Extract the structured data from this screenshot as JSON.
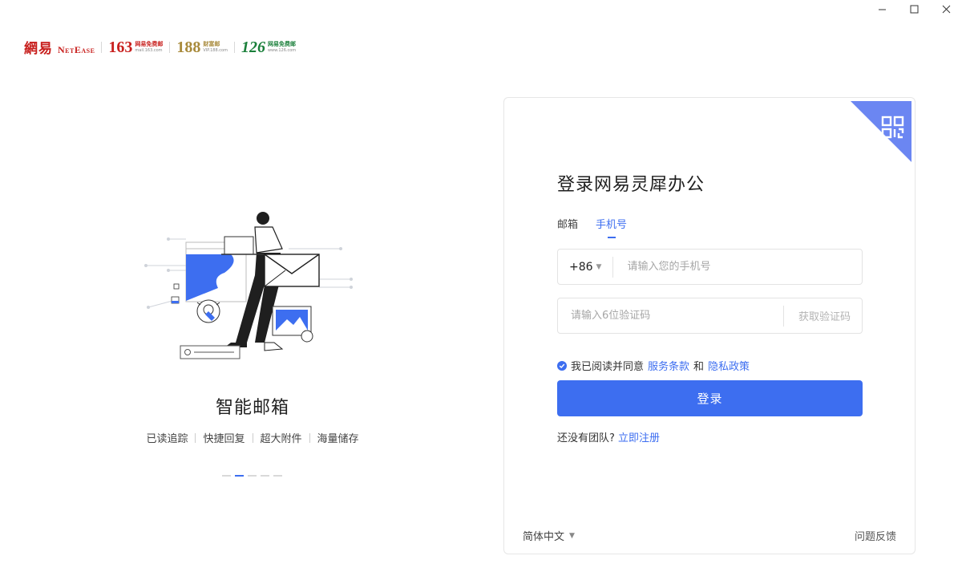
{
  "window": {
    "minimize_label": "−",
    "maximize_label": "☐",
    "close_label": "✕"
  },
  "brand": {
    "netease_cn": "網易",
    "netease_en": "NetEase",
    "b163": {
      "num": "163",
      "title": "网易免费邮",
      "url": "mail.163.com"
    },
    "b188": {
      "num": "188",
      "title": "财富邮",
      "url": "VIP.188.com"
    },
    "b126": {
      "num": "126",
      "title": "网易免费邮",
      "url": "www.126.com"
    }
  },
  "hero": {
    "title": "智能邮箱",
    "features": [
      "已读追踪",
      "快捷回复",
      "超大附件",
      "海量储存"
    ],
    "carousel_count": 5,
    "carousel_active": 1
  },
  "login": {
    "title": "登录网易灵犀办公",
    "tabs": [
      {
        "label": "邮箱",
        "active": false
      },
      {
        "label": "手机号",
        "active": true
      }
    ],
    "country_code": "+86",
    "phone_placeholder": "请输入您的手机号",
    "code_placeholder": "请输入6位验证码",
    "get_code_label": "获取验证码",
    "agree_prefix": "我已阅读并同意",
    "terms_label": "服务条款",
    "agree_and": "和",
    "privacy_label": "隐私政策",
    "login_button": "登录",
    "signup_prefix": "还没有团队?",
    "signup_link": "立即注册",
    "language": "简体中文",
    "feedback": "问题反馈"
  },
  "colors": {
    "accent": "#3d6ef0",
    "brand_red": "#c8201e",
    "brand_gold": "#a88a3b",
    "brand_green": "#1a7f3a"
  },
  "icons": {
    "qr": "qr-code-icon",
    "check": "check-circle-icon",
    "caret": "caret-down-icon"
  }
}
